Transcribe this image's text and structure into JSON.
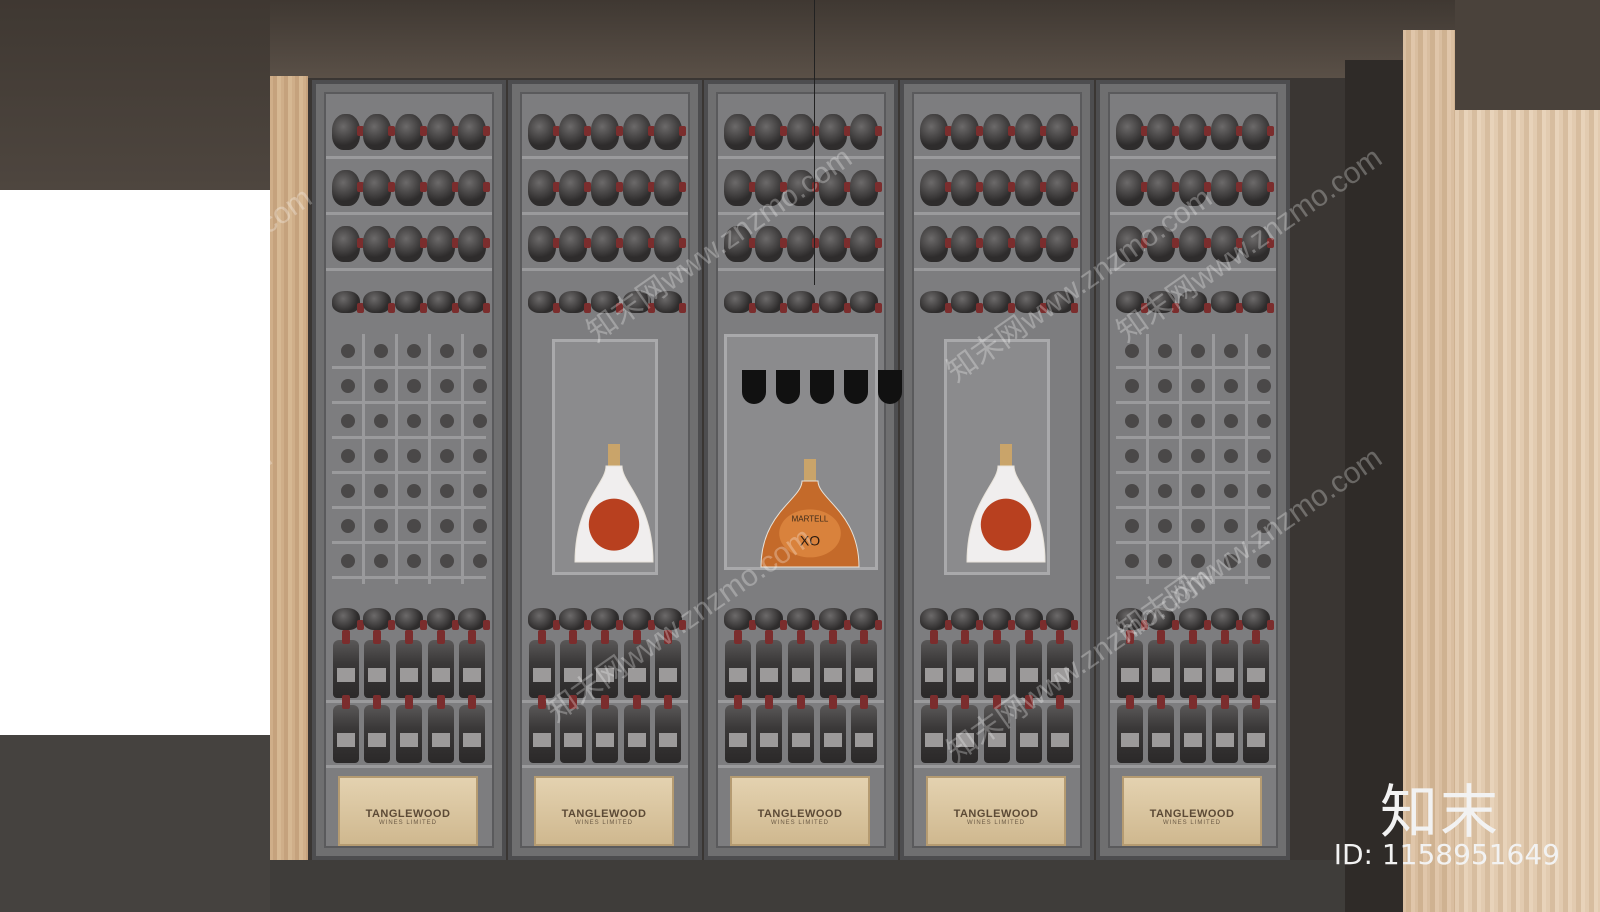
{
  "scene": {
    "crate_brand": "TANGLEWOOD",
    "crate_sub": "WINES LIMITED",
    "cognac_label": "XO",
    "cognac_brand": "MARTELL",
    "logo_text": "知末",
    "id_label": "ID: 1158951649",
    "watermark_text": "知末网www.znzmo.com",
    "cabinet_count": 5,
    "colors": {
      "frame": "#4d4d4f",
      "wood": "#cfae89",
      "cognac": "#c46a2a",
      "ceiling": "#4e463f"
    }
  }
}
